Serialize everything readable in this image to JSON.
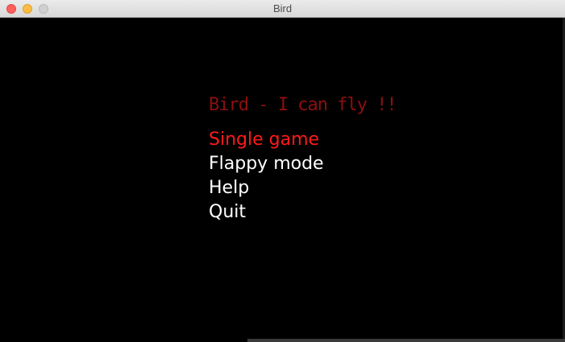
{
  "window": {
    "title": "Bird"
  },
  "game": {
    "title": "Bird - I can fly !!",
    "menu": [
      {
        "label": "Single game",
        "selected": true
      },
      {
        "label": "Flappy mode",
        "selected": false
      },
      {
        "label": "Help",
        "selected": false
      },
      {
        "label": "Quit",
        "selected": false
      }
    ]
  },
  "colors": {
    "background": "#000000",
    "title": "#8e0f0f",
    "selected": "#ff1a1a",
    "menu": "#ffffff"
  },
  "icons": {
    "close": "close-icon",
    "minimize": "minimize-icon",
    "zoom": "zoom-icon"
  }
}
